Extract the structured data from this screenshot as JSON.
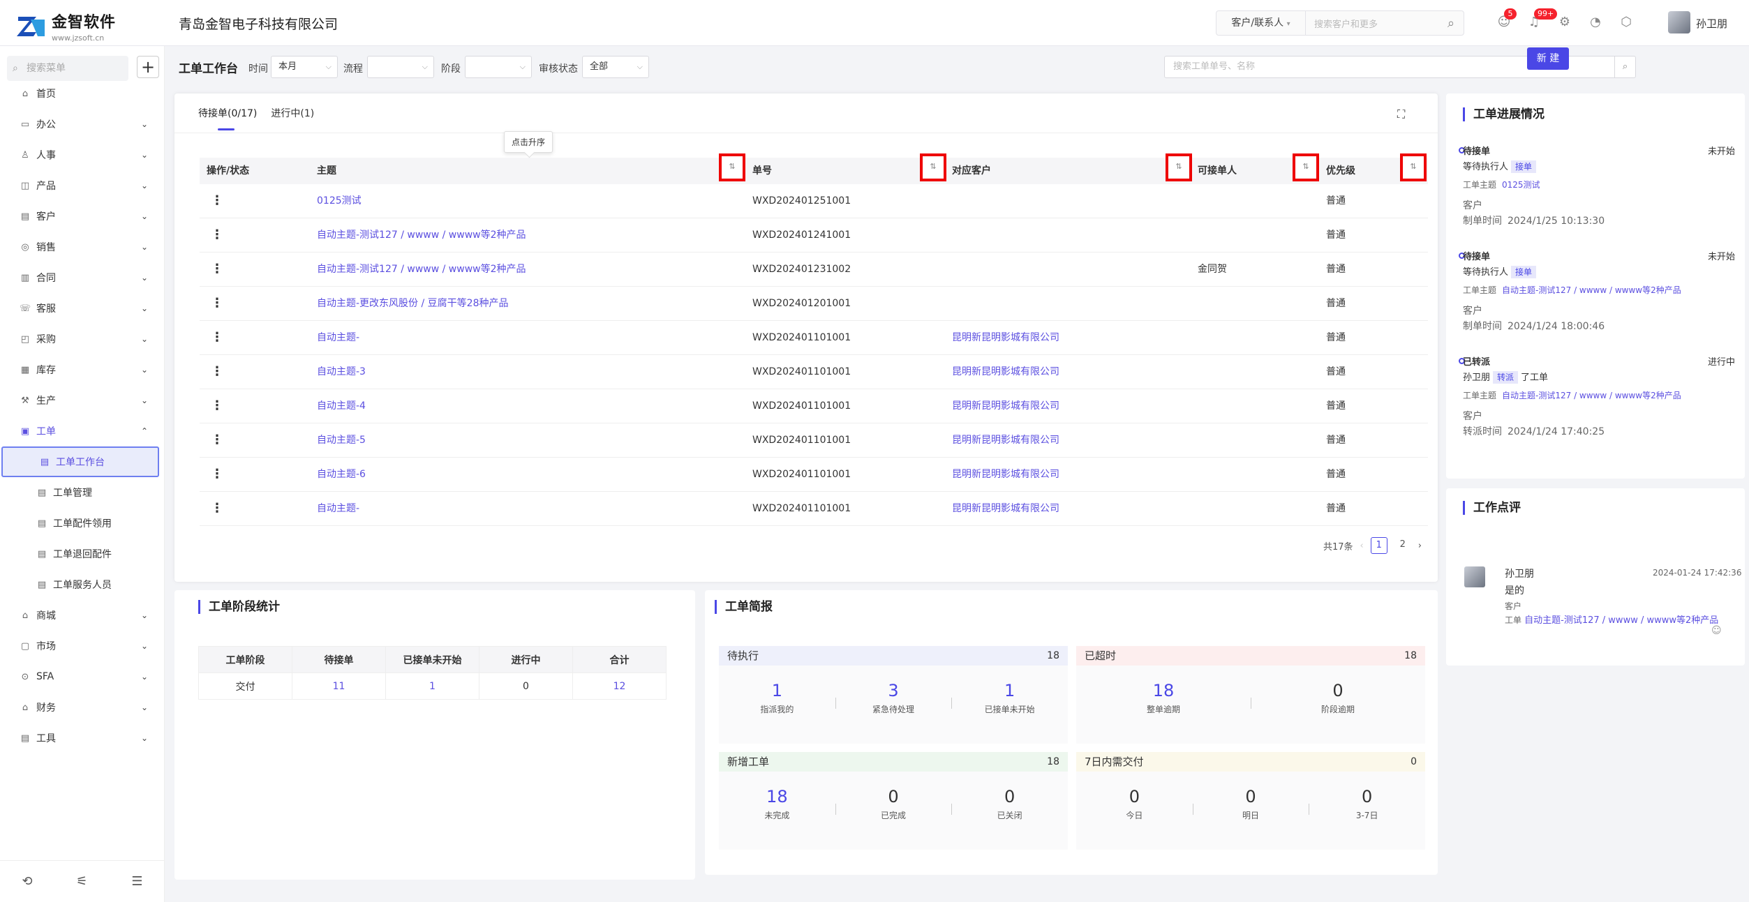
{
  "header": {
    "logo_title": "金智软件",
    "logo_url": "www.jzsoft.cn",
    "company": "青岛金智电子科技有限公司",
    "search_scope": "客户/联系人",
    "search_placeholder": "搜索客户和更多",
    "badge_messages": "5",
    "badge_notices": "99+",
    "user_name": "孙卫朋"
  },
  "sidebar": {
    "search_placeholder": "搜索菜单",
    "items": [
      {
        "label": "首页",
        "icon": "home-icon"
      },
      {
        "label": "办公",
        "icon": "office-icon"
      },
      {
        "label": "人事",
        "icon": "people-icon"
      },
      {
        "label": "产品",
        "icon": "product-icon"
      },
      {
        "label": "客户",
        "icon": "customer-icon"
      },
      {
        "label": "销售",
        "icon": "sales-icon"
      },
      {
        "label": "合同",
        "icon": "contract-icon"
      },
      {
        "label": "客服",
        "icon": "service-icon"
      },
      {
        "label": "采购",
        "icon": "purchase-icon"
      },
      {
        "label": "库存",
        "icon": "inventory-icon"
      },
      {
        "label": "生产",
        "icon": "production-icon"
      },
      {
        "label": "工单",
        "icon": "workorder-icon"
      }
    ],
    "sub_items": [
      {
        "label": "工单工作台"
      },
      {
        "label": "工单管理"
      },
      {
        "label": "工单配件领用"
      },
      {
        "label": "工单退回配件"
      },
      {
        "label": "工单服务人员"
      }
    ],
    "items_after": [
      {
        "label": "商城"
      },
      {
        "label": "市场"
      },
      {
        "label": "SFA"
      },
      {
        "label": "财务"
      },
      {
        "label": "工具"
      }
    ]
  },
  "toolbar": {
    "title": "工单工作台",
    "time_label": "时间",
    "time_value": "本月",
    "flow_label": "流程",
    "stage_label": "阶段",
    "audit_label": "审核状态",
    "audit_value": "全部",
    "search_placeholder": "搜索工单单号、名称",
    "new_button": "新 建"
  },
  "tabs": [
    "待接单(0/17)",
    "进行中(1)"
  ],
  "tooltip": "点击升序",
  "table": {
    "columns": [
      "操作/状态",
      "主题",
      "单号",
      "对应客户",
      "可接单人",
      "优先级"
    ],
    "rows": [
      {
        "subject": "0125测试",
        "no": "WXD202401251001",
        "customer": "",
        "taker": "",
        "priority": "普通"
      },
      {
        "subject": "自动主题-测试127 / wwww / wwww等2种产品",
        "no": "WXD202401241001",
        "customer": "",
        "taker": "",
        "priority": "普通"
      },
      {
        "subject": "自动主题-测试127 / wwww / wwww等2种产品",
        "no": "WXD202401231002",
        "customer": "",
        "taker": "金同贺",
        "priority": "普通"
      },
      {
        "subject": "自动主题-更改东风股份 / 豆腐干等28种产品",
        "no": "WXD202401201001",
        "customer": "",
        "taker": "",
        "priority": "普通"
      },
      {
        "subject": "自动主题-",
        "no": "WXD202401101001",
        "customer": "昆明新昆明影城有限公司",
        "taker": "",
        "priority": "普通"
      },
      {
        "subject": "自动主题-3",
        "no": "WXD202401101001",
        "customer": "昆明新昆明影城有限公司",
        "taker": "",
        "priority": "普通"
      },
      {
        "subject": "自动主题-4",
        "no": "WXD202401101001",
        "customer": "昆明新昆明影城有限公司",
        "taker": "",
        "priority": "普通"
      },
      {
        "subject": "自动主题-5",
        "no": "WXD202401101001",
        "customer": "昆明新昆明影城有限公司",
        "taker": "",
        "priority": "普通"
      },
      {
        "subject": "自动主题-6",
        "no": "WXD202401101001",
        "customer": "昆明新昆明影城有限公司",
        "taker": "",
        "priority": "普通"
      },
      {
        "subject": "自动主题-",
        "no": "WXD202401101001",
        "customer": "昆明新昆明影城有限公司",
        "taker": "",
        "priority": "普通"
      }
    ],
    "total": "共17条",
    "pages": [
      "1",
      "2"
    ],
    "current_page": "1"
  },
  "stage": {
    "title": "工单阶段统计",
    "headers": [
      "工单阶段",
      "待接单",
      "已接单未开始",
      "进行中",
      "合计"
    ],
    "row": [
      "交付",
      "11",
      "1",
      "0",
      "12"
    ]
  },
  "brief": {
    "title": "工单简报",
    "boxes": [
      {
        "name": "待执行",
        "total": "18",
        "color": "#eef0fb",
        "stats": [
          {
            "v": "1",
            "l": "指派我的"
          },
          {
            "v": "3",
            "l": "紧急待处理"
          },
          {
            "v": "1",
            "l": "已接单未开始"
          }
        ]
      },
      {
        "name": "已超时",
        "total": "18",
        "color": "#fdeeee",
        "stats": [
          {
            "v": "18",
            "l": "整单逾期"
          },
          {
            "v": "0",
            "l": "阶段逾期"
          }
        ]
      },
      {
        "name": "新增工单",
        "total": "18",
        "color": "#edf7ee",
        "stats": [
          {
            "v": "18",
            "l": "未完成"
          },
          {
            "v": "0",
            "l": "已完成"
          },
          {
            "v": "0",
            "l": "已关闭"
          }
        ]
      },
      {
        "name": "7日内需交付",
        "total": "0",
        "color": "#fbf8ea",
        "stats": [
          {
            "v": "0",
            "l": "今日"
          },
          {
            "v": "0",
            "l": "明日"
          },
          {
            "v": "0",
            "l": "3-7日"
          }
        ]
      }
    ]
  },
  "progress": {
    "title": "工单进展情况",
    "items": [
      {
        "status": "待接单",
        "state": "未开始",
        "line2a": "等待执行人",
        "tag": "接单",
        "line2b": "",
        "subject_label": "工单主题",
        "subject": "0125测试",
        "customer_label": "客户",
        "time_label": "制单时间",
        "time": "2024/1/25 10:13:30"
      },
      {
        "status": "待接单",
        "state": "未开始",
        "line2a": "等待执行人",
        "tag": "接单",
        "line2b": "",
        "subject_label": "工单主题",
        "subject": "自动主题-测试127 / wwww / wwww等2种产品",
        "customer_label": "客户",
        "time_label": "制单时间",
        "time": "2024/1/24 18:00:46"
      },
      {
        "status": "已转派",
        "state": "进行中",
        "line2a": "孙卫朋",
        "tag": "转派",
        "line2b": "了工单",
        "subject_label": "工单主题",
        "subject": "自动主题-测试127 / wwww / wwww等2种产品",
        "customer_label": "客户",
        "time_label": "转派时间",
        "time": "2024/1/24 17:40:25"
      }
    ]
  },
  "comment": {
    "title": "工作点评",
    "user": "孙卫朋",
    "time": "2024-01-24 17:42:36",
    "text": "是的",
    "customer_label": "客户",
    "order_label": "工单",
    "order": "自动主题-测试127 / wwww / wwww等2种产品"
  }
}
